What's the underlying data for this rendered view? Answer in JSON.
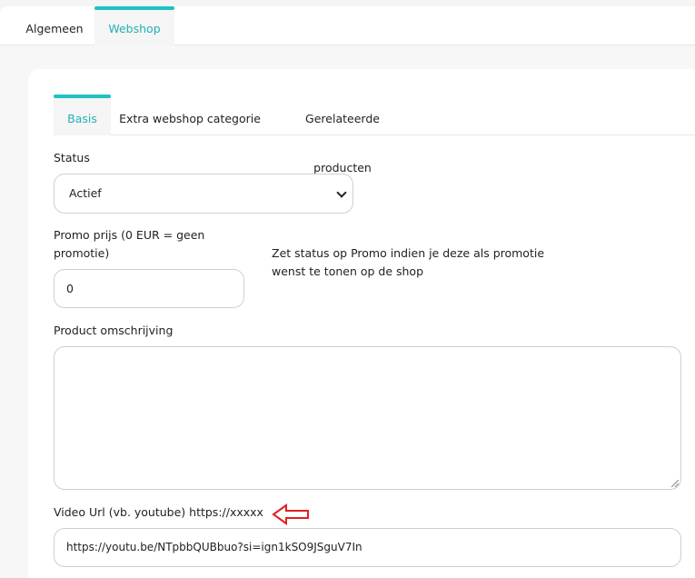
{
  "top_tabs": [
    {
      "label": "Algemeen",
      "active": false
    },
    {
      "label": "Webshop",
      "active": true
    }
  ],
  "sub_tabs": [
    {
      "label": "Basis",
      "active": true
    },
    {
      "label": "Extra webshop categorie",
      "active": false
    },
    {
      "label": "Gerelateerde producten",
      "active": false
    }
  ],
  "form": {
    "status_label": "Status",
    "status_value": "Actief",
    "promo_label": "Promo prijs (0 EUR = geen promotie)",
    "promo_value": "0",
    "promo_hint": "Zet status op Promo indien je deze als promotie wenst te tonen op de shop",
    "description_label": "Product omschrijving",
    "description_value": "",
    "video_label": "Video Url (vb. youtube) https://xxxxx",
    "video_value": "https://youtu.be/NTpbbQUBbuo?si=ign1kSO9JSguV7In"
  },
  "colors": {
    "accent": "#1fc1c3",
    "accent_text": "#20b2b5",
    "annotation_arrow": "#e02020"
  },
  "icons": {
    "select_chevron": "chevron-down-icon",
    "annotation": "arrow-left-icon"
  }
}
